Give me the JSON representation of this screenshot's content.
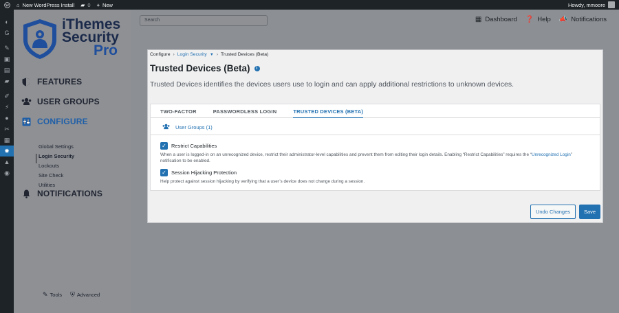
{
  "admin_bar": {
    "site_name": "New WordPress Install",
    "comments_count": "0",
    "new_label": "New",
    "howdy": "Howdy, mmoore"
  },
  "wp_menu": {
    "icons": [
      "dashboard-icon",
      "gauge-icon",
      "pin-icon",
      "media-icon",
      "pages-icon",
      "comments-icon",
      "appearance-icon",
      "plugins-icon",
      "users-icon",
      "tools-icon",
      "settings-icon",
      "security-icon",
      "lock-icon",
      "collapse-icon"
    ]
  },
  "brand": {
    "line1": "iThemes",
    "line2": "Security",
    "line3": "Pro"
  },
  "sidebar": {
    "features": "FEATURES",
    "user_groups": "USER GROUPS",
    "configure": "CONFIGURE",
    "sub_items": [
      {
        "label": "Global Settings"
      },
      {
        "label": "Login Security"
      },
      {
        "label": "Lockouts"
      },
      {
        "label": "Site Check"
      },
      {
        "label": "Utilities"
      }
    ],
    "notifications": "NOTIFICATIONS",
    "tools": "Tools",
    "advanced": "Advanced"
  },
  "search": {
    "placeholder": "Search"
  },
  "topnav": {
    "dashboard": "Dashboard",
    "help": "Help",
    "notifications": "Notifications"
  },
  "breadcrumb": {
    "root": "Configure",
    "section": "Login Security",
    "current": "Trusted Devices (Beta)"
  },
  "page": {
    "title": "Trusted Devices (Beta)",
    "description": "Trusted Devices identifies the devices users use to login and can apply additional restrictions to unknown devices."
  },
  "tabs": [
    {
      "label": "TWO-FACTOR"
    },
    {
      "label": "PASSWORDLESS LOGIN"
    },
    {
      "label": "TRUSTED DEVICES (BETA)"
    }
  ],
  "user_groups_link": "User Groups (1)",
  "options": {
    "restrict": {
      "label": "Restrict Capabilities",
      "help_a": "When a user is logged-in on an unrecognized device, restrict their administrator-level capabilities and prevent them from editing their login details. Enabling “Restrict Capabilities” requires the",
      "help_open": "“",
      "help_link": "Unrecognized Login",
      "help_b": "” notification to be enabled."
    },
    "hijack": {
      "label": "Session Hijacking Protection",
      "help": "Help protect against session hijacking by verifying that a user’s device does not change during a session."
    }
  },
  "buttons": {
    "undo": "Undo Changes",
    "save": "Save"
  }
}
